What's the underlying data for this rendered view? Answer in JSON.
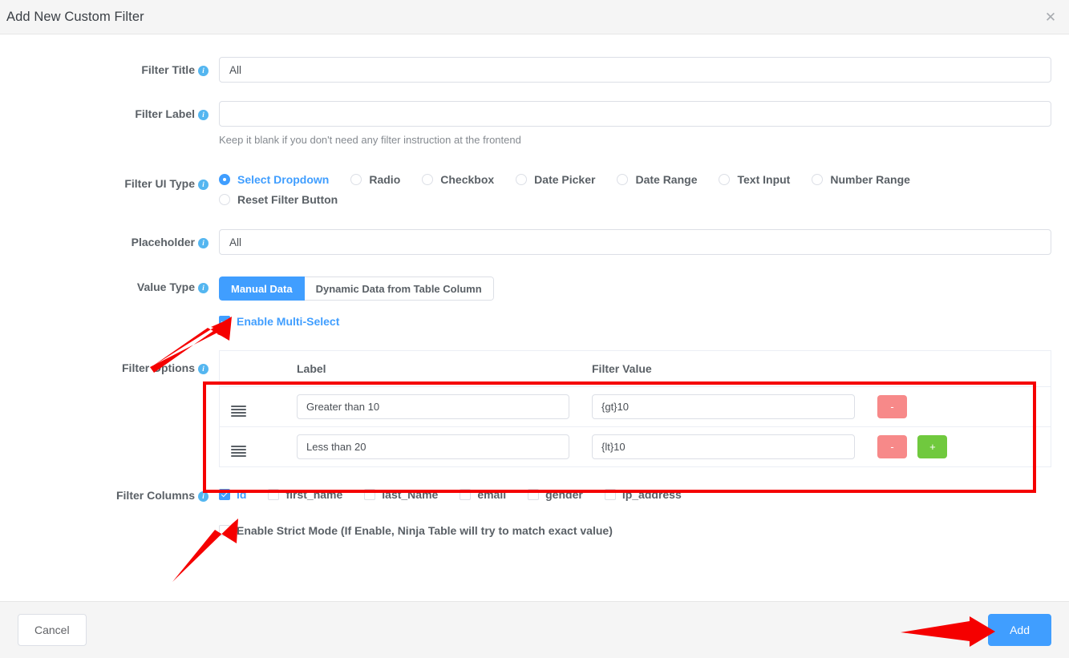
{
  "header": {
    "title": "Add New Custom Filter",
    "close_label": "✕"
  },
  "fields": {
    "filter_title": {
      "label": "Filter Title",
      "value": "All",
      "placeholder": ""
    },
    "filter_label": {
      "label": "Filter Label",
      "value": "",
      "placeholder": "",
      "hint": "Keep it blank if you don't need any filter instruction at the frontend"
    },
    "filter_ui_type": {
      "label": "Filter UI Type",
      "selected": "Select Dropdown",
      "options": [
        "Select Dropdown",
        "Radio",
        "Checkbox",
        "Date Picker",
        "Date Range",
        "Text Input",
        "Number Range",
        "Reset Filter Button"
      ]
    },
    "placeholder": {
      "label": "Placeholder",
      "value": "All",
      "placeholder": ""
    },
    "value_type": {
      "label": "Value Type",
      "selected": "Manual Data",
      "options": [
        "Manual Data",
        "Dynamic Data from Table Column"
      ]
    },
    "enable_multi_select": {
      "label": "Enable Multi-Select",
      "checked": true
    },
    "filter_options": {
      "label": "Filter Options",
      "columns": [
        "",
        "Label",
        "Filter Value",
        ""
      ],
      "rows": [
        {
          "handle_icon": "drag-handle-icon",
          "label": "Greater than 10",
          "value": "{gt}10",
          "buttons": [
            "-"
          ]
        },
        {
          "handle_icon": "drag-handle-icon",
          "label": "Less than 20",
          "value": "{lt}10",
          "buttons": [
            "-",
            "+"
          ]
        }
      ]
    },
    "filter_columns": {
      "label": "Filter Columns",
      "items": [
        {
          "label": "id",
          "checked": true
        },
        {
          "label": "first_name",
          "checked": false
        },
        {
          "label": "last_Name",
          "checked": false
        },
        {
          "label": "email",
          "checked": false
        },
        {
          "label": "gender",
          "checked": false
        },
        {
          "label": "ip_address",
          "checked": false
        }
      ]
    },
    "strict_mode": {
      "label": "Enable Strict Mode (If Enable, Ninja Table will try to match exact value)",
      "checked": false
    }
  },
  "footer": {
    "cancel_label": "Cancel",
    "add_label": "Add"
  },
  "colors": {
    "accent_blue": "#409eff",
    "info_blue": "#54b6f0",
    "danger_red": "#f78989",
    "success_green": "#70c93e",
    "annotation_red": "#f50000",
    "header_bg": "#f5f5f5",
    "border": "#dcdfe6",
    "label_text": "#5a6066"
  },
  "annotations": {
    "arrow_value_type": "red-arrow-pointing-to-manual-data-tab",
    "arrow_filter_columns": "red-arrow-pointing-to-id-checkbox",
    "arrow_add_button": "red-arrow-pointing-to-add-button",
    "rect_filter_options": "red-rectangle-around-filter-options-table"
  }
}
